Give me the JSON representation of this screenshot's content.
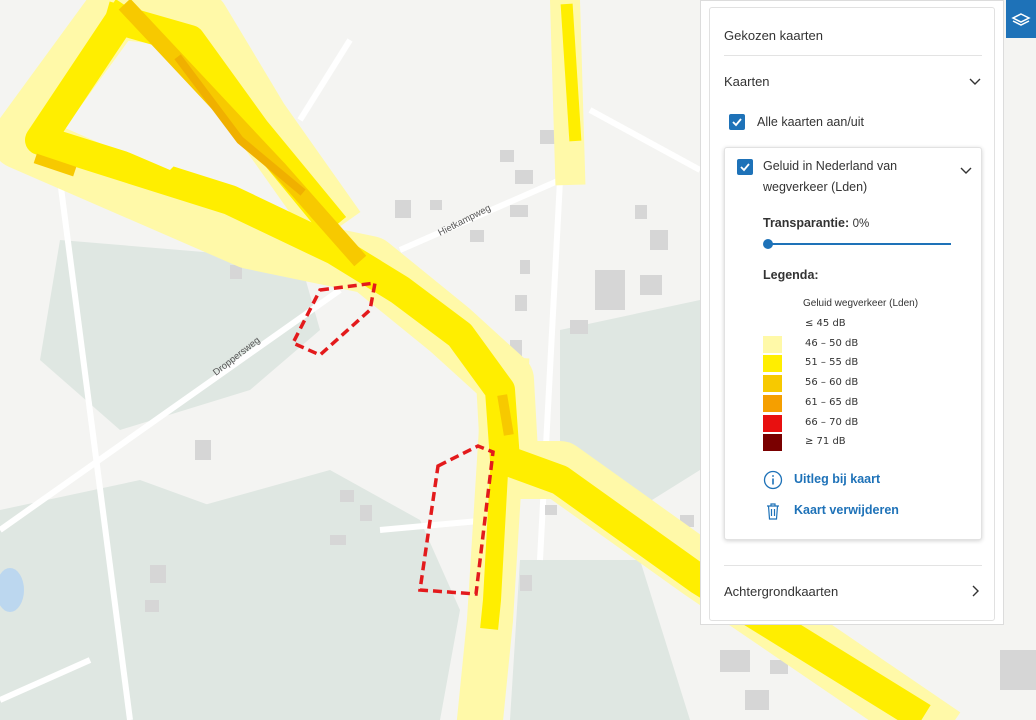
{
  "colors": {
    "accent": "#1e72b8",
    "boundary": "#e31a1c",
    "noise_46_50": "#fff9a8",
    "noise_51_55": "#ffee00",
    "noise_56_60": "#f7c900",
    "noise_61_65": "#f59f00",
    "noise_66_70": "#e81010",
    "noise_71": "#7a0000"
  },
  "map": {
    "street_labels": [
      "Hietkampweg",
      "Droppersweg"
    ]
  },
  "panel": {
    "title": "Gekozen kaarten",
    "maps_section": "Kaarten",
    "all_maps_toggle": "Alle kaarten aan/uit",
    "layer": {
      "name": "Geluid in Nederland van wegverkeer (Lden)",
      "transparency_label": "Transparantie:",
      "transparency_value": "0%",
      "legend_label": "Legenda:",
      "legend_title": "Geluid wegverkeer (Lden)",
      "legend_items": [
        {
          "label": "≤ 45 dB",
          "color": "transparent"
        },
        {
          "label": "46 – 50 dB",
          "color": "#fff9a8"
        },
        {
          "label": "51 – 55 dB",
          "color": "#ffee00"
        },
        {
          "label": "56 – 60 dB",
          "color": "#f7c900"
        },
        {
          "label": "61 – 65 dB",
          "color": "#f59f00"
        },
        {
          "label": "66 – 70 dB",
          "color": "#e81010"
        },
        {
          "label": "≥ 71 dB",
          "color": "#7a0000"
        }
      ],
      "info_link": "Uitleg bij kaart",
      "remove_link": "Kaart verwijderen"
    },
    "background_section": "Achtergrondkaarten"
  }
}
